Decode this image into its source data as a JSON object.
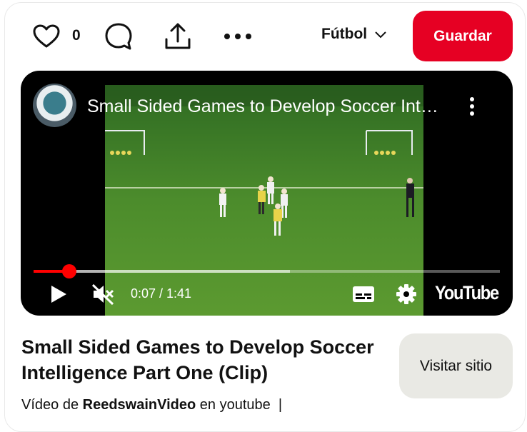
{
  "toolbar": {
    "like_count": "0",
    "board_name": "Fútbol",
    "save_label": "Guardar",
    "icons": [
      "heart-icon",
      "comment-icon",
      "share-icon",
      "more-icon",
      "chevron-down-icon"
    ]
  },
  "video": {
    "title": "Small Sided Games to Develop Soccer Intelligence Part One (Clip)",
    "time": "0:07 / 1:41",
    "brand": "YouTube",
    "progress_played": 0.077,
    "progress_buffered": 0.55,
    "icons": [
      "channel-avatar",
      "menu-dots-icon",
      "play-icon",
      "mute-icon",
      "captions-icon",
      "settings-icon"
    ]
  },
  "pin": {
    "title": "Small Sided Games to Develop Soccer Intelligence Part One (Clip)",
    "visit_label": "Visitar sitio",
    "source_prefix": "Vídeo de",
    "source_author": "ReedswainVideo",
    "source_suffix": "en youtube",
    "source_sep": "|"
  },
  "colors": {
    "accent": "#e60023",
    "progress": "#ff0000",
    "visit_bg": "#e9e9e4"
  }
}
